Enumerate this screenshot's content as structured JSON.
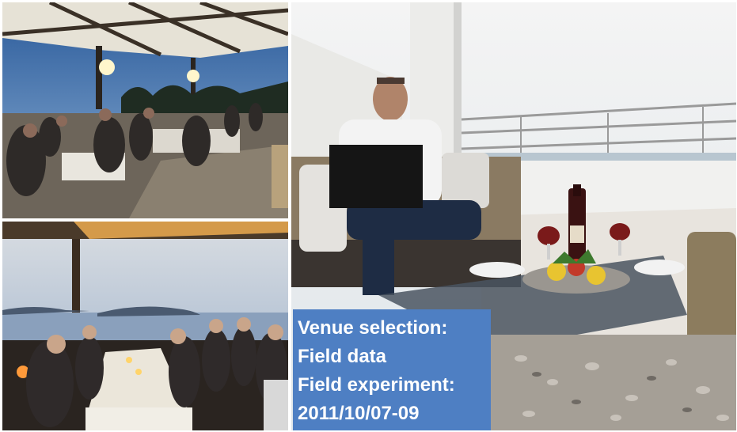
{
  "caption": {
    "lines": [
      "Venue selection:",
      "Field data",
      "Field experiment:",
      "2011/10/07-09"
    ],
    "background_color": "#4e7fc3",
    "text_color": "#ffffff"
  },
  "photos": [
    {
      "subject": "outdoor terrace dinner at dusk"
    },
    {
      "subject": "long table dinner under a pergola at sunset"
    },
    {
      "subject": "man with laptop on a balcony sofa, wine and fruit on a table"
    }
  ]
}
